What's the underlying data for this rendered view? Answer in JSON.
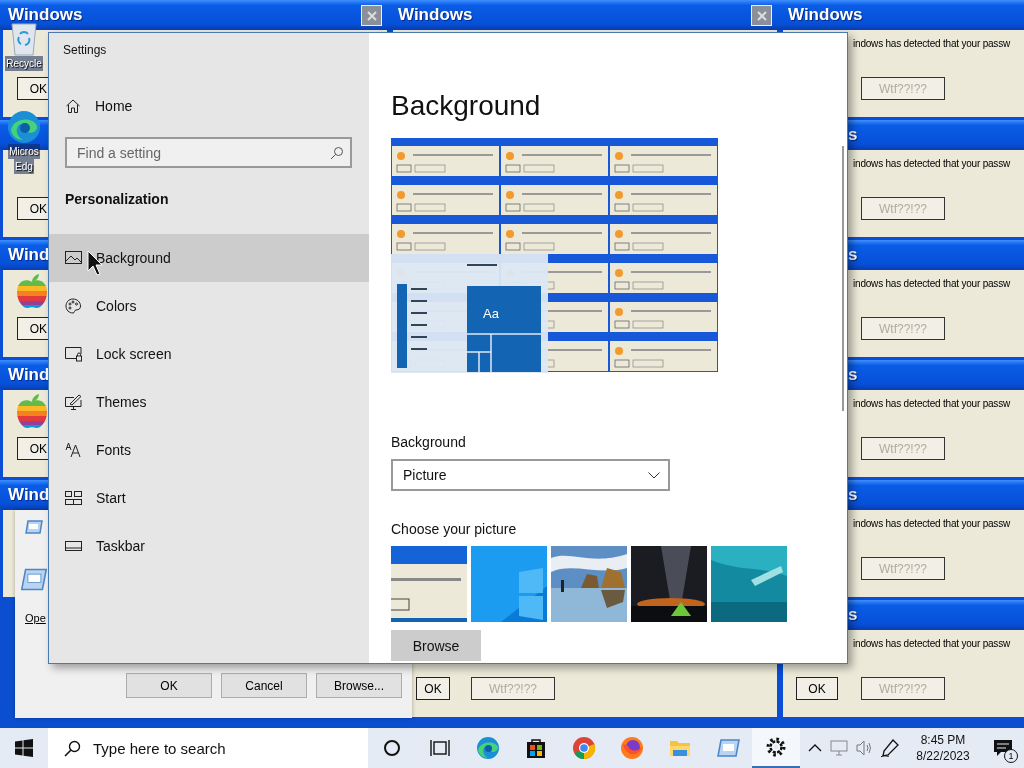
{
  "desktop": {
    "icons": [
      {
        "lines": [
          "Recycle"
        ]
      },
      {
        "lines": [
          "Micros",
          "Edg"
        ]
      }
    ],
    "dialogs": [
      {
        "title": "Windows",
        "buttons": [
          {
            "label": "OK",
            "disabled": false
          }
        ]
      },
      {
        "title": "Windows"
      },
      {
        "title": "Windows",
        "message": "indows has detected that your passw",
        "buttons": [
          {
            "label": "Wtf??!??",
            "disabled": true
          }
        ]
      },
      {
        "buttons": [
          {
            "label": "OK",
            "disabled": false
          }
        ]
      },
      {
        "title": "s",
        "message": "indows has detected that your passw",
        "buttons": [
          {
            "label": "Wtf??!??",
            "disabled": true
          }
        ]
      },
      {
        "title": "Wind",
        "buttons": [
          {
            "label": "OK",
            "disabled": false
          }
        ]
      },
      {
        "title": "s",
        "message": "indows has detected that your passw",
        "buttons": [
          {
            "label": "Wtf??!??",
            "disabled": true
          }
        ]
      },
      {
        "title": "Wind",
        "buttons": [
          {
            "label": "OK",
            "disabled": false
          }
        ]
      },
      {
        "title": "s",
        "message": "indows has detected that your passw",
        "buttons": [
          {
            "label": "Wtf??!??",
            "disabled": true
          }
        ]
      },
      {
        "title": "Wind"
      },
      {
        "title": "s",
        "message": "indows has detected that your passw",
        "buttons": [
          {
            "label": "Wtf??!??",
            "disabled": true
          }
        ]
      },
      {
        "buttons": [
          {
            "label": "OK",
            "disabled": false
          },
          {
            "label": "Wtf??!??",
            "disabled": true
          }
        ]
      },
      {
        "title": "s",
        "message": "indows has detected that your passw",
        "buttons": [
          {
            "label": "OK",
            "disabled": false
          },
          {
            "label": "Wtf??!??",
            "disabled": true
          }
        ]
      }
    ],
    "run_dialog": {
      "label": "Ope",
      "buttons": [
        "OK",
        "Cancel",
        "Browse..."
      ]
    }
  },
  "settings": {
    "window_title": "Settings",
    "home": "Home",
    "search": {
      "placeholder": "Find a setting"
    },
    "section": "Personalization",
    "nav": [
      {
        "label": "Background",
        "kind": "picture",
        "selected": true
      },
      {
        "label": "Colors",
        "kind": "palette",
        "selected": false
      },
      {
        "label": "Lock screen",
        "kind": "lock",
        "selected": false
      },
      {
        "label": "Themes",
        "kind": "themes",
        "selected": false
      },
      {
        "label": "Fonts",
        "kind": "fonts",
        "selected": false
      },
      {
        "label": "Start",
        "kind": "start",
        "selected": false
      },
      {
        "label": "Taskbar",
        "kind": "taskbar",
        "selected": false
      }
    ],
    "page": {
      "title": "Background",
      "preview": {
        "sample": "Aa"
      },
      "background_label": "Background",
      "background_select": {
        "value": "Picture"
      },
      "choose_label": "Choose your picture",
      "browse": "Browse"
    }
  },
  "taskbar": {
    "search": {
      "placeholder": "Type here to search"
    },
    "apps": [
      {
        "kind": "cortana",
        "selected": false
      },
      {
        "kind": "taskview",
        "selected": false
      },
      {
        "kind": "edge",
        "selected": false
      },
      {
        "kind": "store",
        "selected": false
      },
      {
        "kind": "chrome",
        "selected": false
      },
      {
        "kind": "firefox",
        "selected": false
      },
      {
        "kind": "folder",
        "selected": false
      },
      {
        "kind": "app",
        "selected": false
      },
      {
        "kind": "settings",
        "selected": true
      }
    ],
    "clock": {
      "time": "8:45 PM",
      "date": "8/22/2023"
    },
    "notifications": {
      "count": "1"
    }
  }
}
